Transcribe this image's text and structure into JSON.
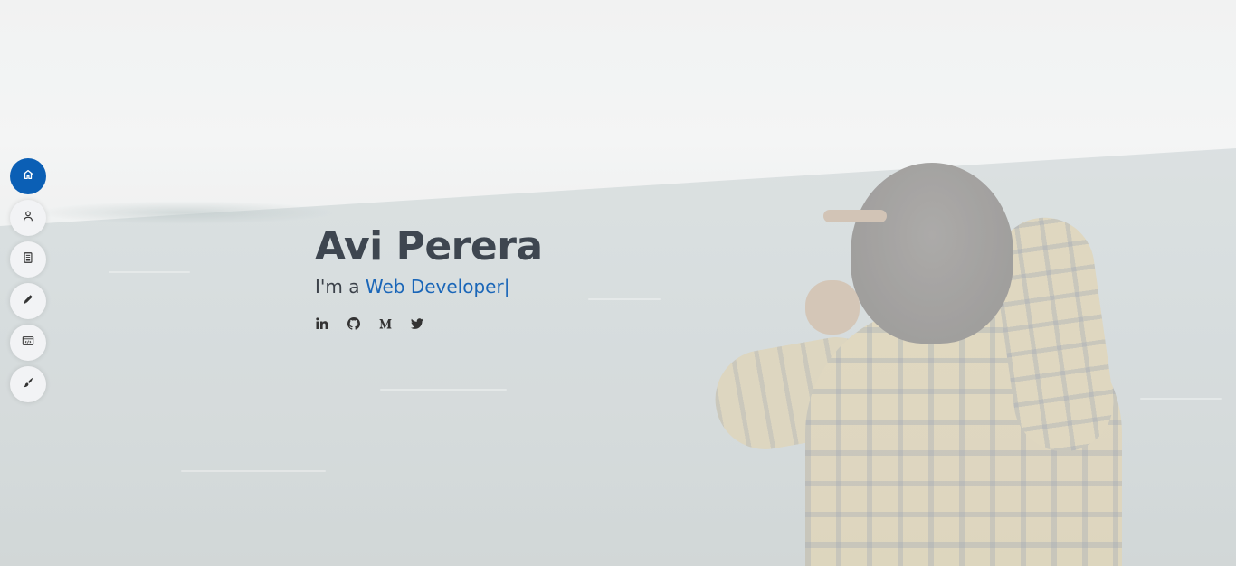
{
  "hero": {
    "name": "Avi Perera",
    "tagline_prefix": "I'm a ",
    "typed_text": "Web Developer",
    "cursor": "|"
  },
  "sidenav": {
    "items": [
      {
        "icon": "home-icon",
        "active": true
      },
      {
        "icon": "user-icon",
        "active": false
      },
      {
        "icon": "document-icon",
        "active": false
      },
      {
        "icon": "pen-icon",
        "active": false
      },
      {
        "icon": "code-window-icon",
        "active": false
      },
      {
        "icon": "brush-icon",
        "active": false
      }
    ]
  },
  "socials": {
    "items": [
      {
        "icon": "linkedin-icon"
      },
      {
        "icon": "github-icon"
      },
      {
        "icon": "medium-icon",
        "glyph": "M"
      },
      {
        "icon": "twitter-icon"
      }
    ]
  },
  "colors": {
    "accent": "#0b5fb5",
    "typed_text": "#1a66b8",
    "name_text": "#3e4650",
    "nav_button_bg": "#f2f3f5"
  }
}
